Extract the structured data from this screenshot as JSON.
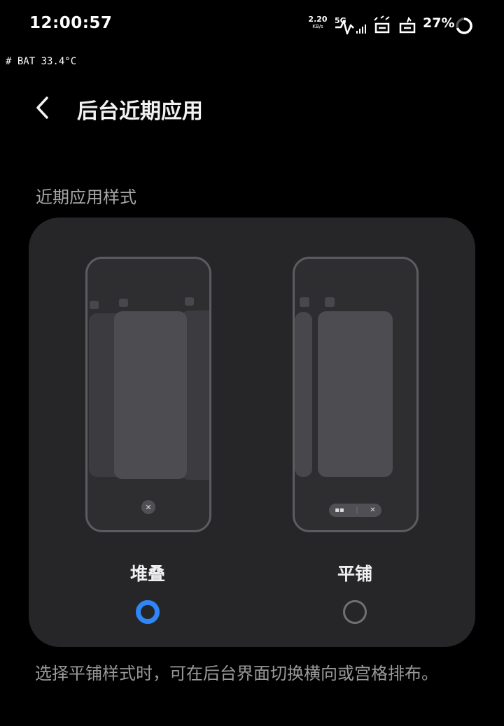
{
  "status_bar": {
    "time": "12:00:57",
    "net_speed_value": "2.20",
    "net_speed_unit": "KB/s",
    "network_type": "5G",
    "battery_percent": "27%"
  },
  "debug_overlay": "# BAT 33.4°C",
  "header": {
    "title": "后台近期应用"
  },
  "section": {
    "title": "近期应用样式"
  },
  "options": [
    {
      "label": "堆叠",
      "selected": true
    },
    {
      "label": "平铺",
      "selected": false
    }
  ],
  "footnote": "选择平铺样式时，可在后台界面切换横向或宫格排布。",
  "colors": {
    "accent": "#2f86f6",
    "card_bg": "#262628",
    "background": "#000000"
  }
}
